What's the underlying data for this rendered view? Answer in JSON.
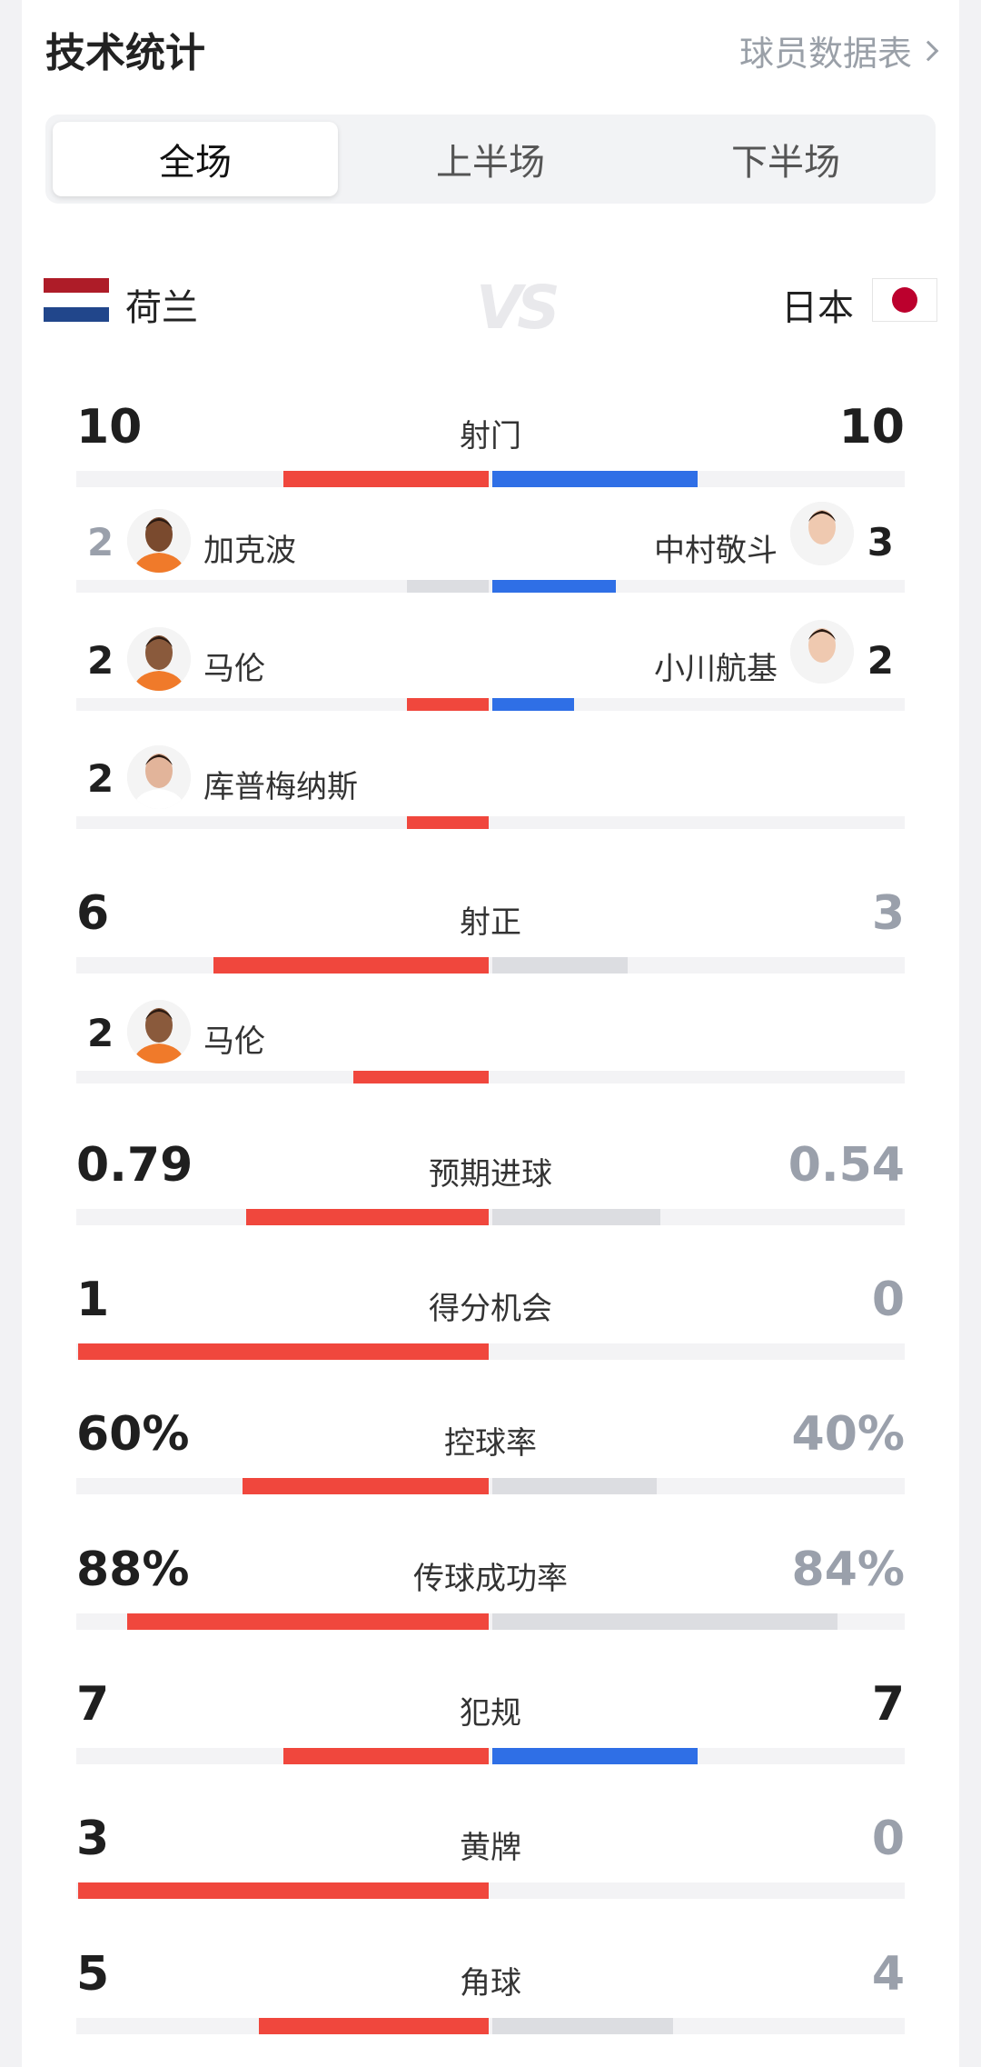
{
  "header": {
    "title": "技术统计",
    "link": "球员数据表"
  },
  "tabs": [
    "全场",
    "上半场",
    "下半场"
  ],
  "teams": {
    "home": "荷兰",
    "away": "日本",
    "vs": "VS"
  },
  "colors": {
    "home": "#f0473d",
    "away": "#2f6fe6",
    "neutral": "#dcdde1"
  },
  "stats": [
    {
      "label": "射门",
      "home": "10",
      "away": "10",
      "home_frac": 0.5,
      "away_frac": 0.5
    },
    {
      "label": "射正",
      "home": "6",
      "away": "3",
      "home_frac": 0.67,
      "away_frac": 0.33
    },
    {
      "label": "预期进球",
      "home": "0.79",
      "away": "0.54",
      "home_frac": 0.59,
      "away_frac": 0.41
    },
    {
      "label": "得分机会",
      "home": "1",
      "away": "0",
      "home_frac": 1.0,
      "away_frac": 0.0
    },
    {
      "label": "控球率",
      "home": "60%",
      "away": "40%",
      "home_frac": 0.6,
      "away_frac": 0.4
    },
    {
      "label": "传球成功率",
      "home": "88%",
      "away": "84%",
      "home_frac": 0.88,
      "away_frac": 0.84
    },
    {
      "label": "犯规",
      "home": "7",
      "away": "7",
      "home_frac": 0.5,
      "away_frac": 0.5
    },
    {
      "label": "黄牌",
      "home": "3",
      "away": "0",
      "home_frac": 1.0,
      "away_frac": 0.0
    },
    {
      "label": "角球",
      "home": "5",
      "away": "4",
      "home_frac": 0.56,
      "away_frac": 0.44
    }
  ],
  "players": [
    {
      "home_num": "2",
      "home_name": "加克波",
      "away_num": "3",
      "away_name": "中村敬斗",
      "home_frac": 0.2,
      "away_frac": 0.3
    },
    {
      "home_num": "2",
      "home_name": "马伦",
      "away_num": "2",
      "away_name": "小川航基",
      "home_frac": 0.2,
      "away_frac": 0.2
    },
    {
      "home_num": "2",
      "home_name": "库普梅纳斯",
      "home_frac": 0.2
    },
    {
      "home_num": "2",
      "home_name": "马伦",
      "home_frac": 0.33
    }
  ]
}
